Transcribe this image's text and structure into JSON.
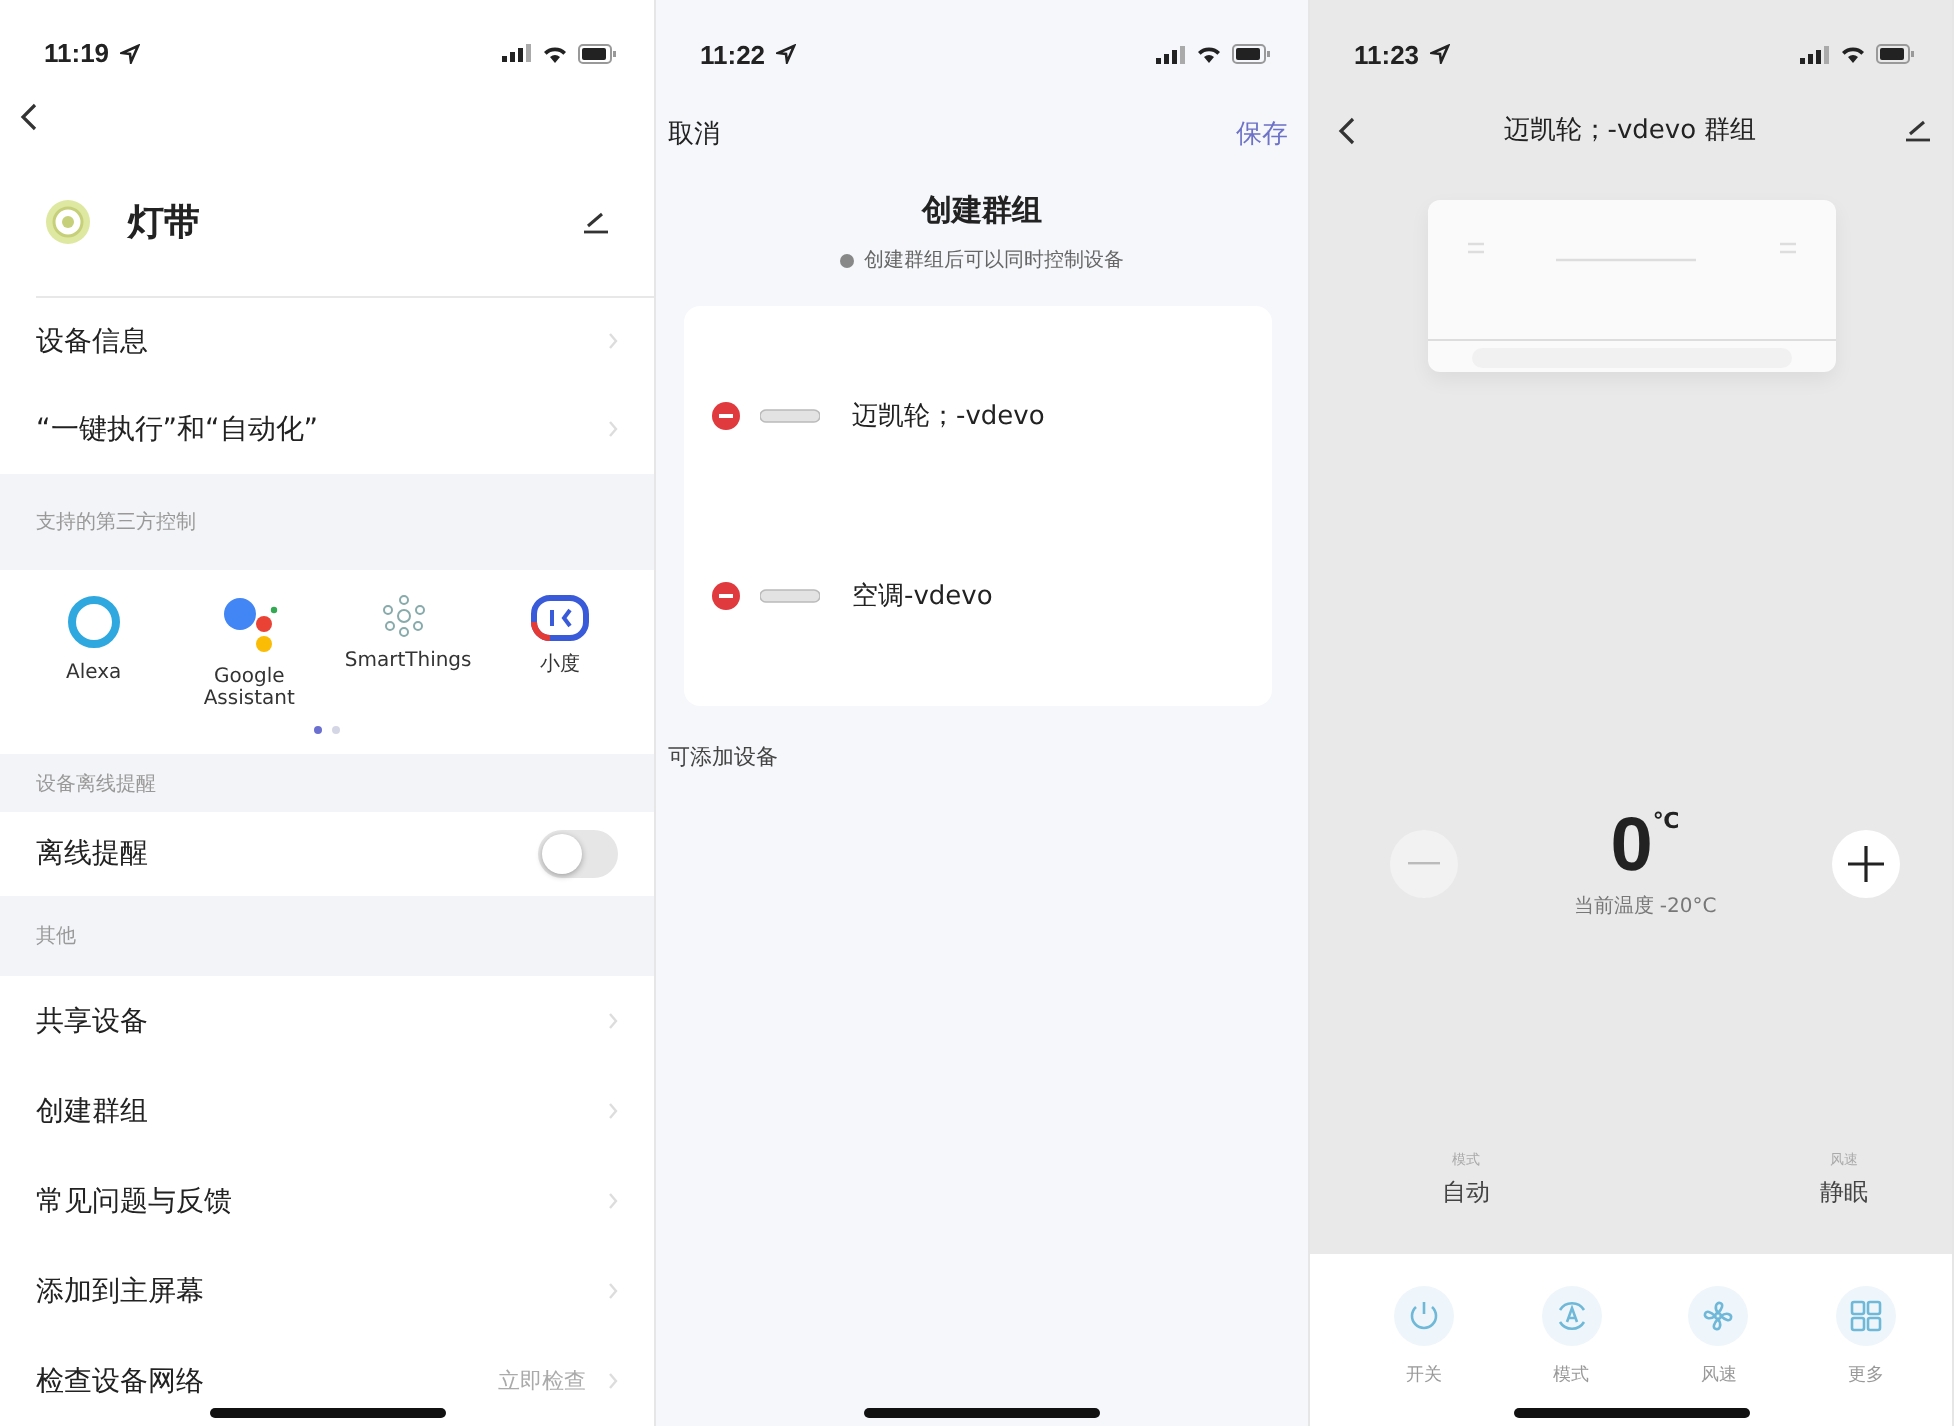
{
  "settings_screen": {
    "status_time": "11:19",
    "device_name": "灯带",
    "info_rows": [
      {
        "label": "设备信息"
      },
      {
        "label": "“一键执行”和“自动化”"
      }
    ],
    "third_party": {
      "header": "支持的第三方控制",
      "services": [
        {
          "kind": "alexa",
          "name": "Alexa"
        },
        {
          "kind": "google",
          "name": "Google Assistant"
        },
        {
          "kind": "smartthings",
          "name": "SmartThings"
        },
        {
          "kind": "xiaodu",
          "name": "小度"
        }
      ],
      "pages": [
        {
          "selected": true
        },
        {
          "selected": false
        }
      ]
    },
    "offline": {
      "header": "设备离线提醒",
      "label": "离线提醒",
      "on": false
    },
    "other": {
      "header": "其他",
      "rows": [
        {
          "label": "共享设备"
        },
        {
          "label": "创建群组"
        },
        {
          "label": "常见问题与反馈"
        },
        {
          "label": "添加到主屏幕"
        },
        {
          "label": "检查设备网络",
          "value": "立即检查"
        }
      ]
    }
  },
  "group_create_screen": {
    "status_time": "11:22",
    "cancel": "取消",
    "save": "保存",
    "title": "创建群组",
    "hint": "创建群组后可以同时控制设备",
    "members": [
      {
        "name": "迈凯轮；-vdevo"
      },
      {
        "name": "空调-vdevo"
      }
    ],
    "available_header": "可添加设备"
  },
  "group_control_screen": {
    "status_time": "11:23",
    "title": "迈凯轮；-vdevo 群组",
    "temperature": "0",
    "unit": "℃",
    "current": "当前温度 -20°C",
    "settings": [
      {
        "label": "模式",
        "value": "自动"
      },
      {
        "label": "风速",
        "value": "静眠"
      }
    ],
    "actions": [
      {
        "kind": "power",
        "label": "开关"
      },
      {
        "kind": "mode",
        "label": "模式"
      },
      {
        "kind": "fan",
        "label": "风速"
      },
      {
        "kind": "more",
        "label": "更多"
      }
    ]
  }
}
